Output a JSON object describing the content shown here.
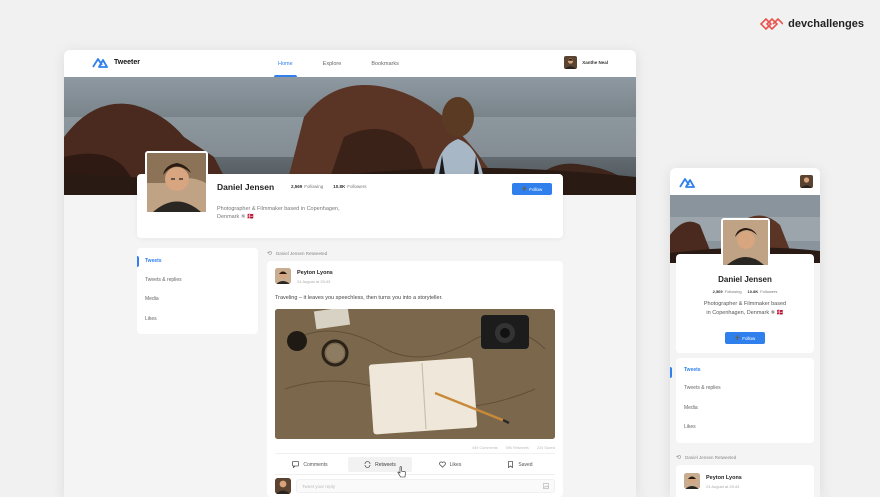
{
  "brand": {
    "name": "devchallenges"
  },
  "desktop": {
    "app_name": "Tweeter",
    "nav": [
      {
        "label": "Home",
        "active": true
      },
      {
        "label": "Explore",
        "active": false
      },
      {
        "label": "Bookmarks",
        "active": false
      }
    ],
    "current_user": "Xanthe Neal",
    "profile": {
      "name": "Daniel Jensen",
      "following_count": "2,569",
      "following_label": "Following",
      "followers_count": "10.8K",
      "followers_label": "Followers",
      "bio_line1": "Photographer & Filmmaker based in Copenhagen,",
      "bio_line2": "Denmark ✵ 🇩🇰",
      "follow_label": "Follow"
    },
    "filters": [
      {
        "label": "Tweets",
        "active": true
      },
      {
        "label": "Tweets & replies",
        "active": false
      },
      {
        "label": "Media",
        "active": false
      },
      {
        "label": "Likes",
        "active": false
      }
    ],
    "retweet_note": "Daniel Jensen Retweeted",
    "tweet": {
      "author": "Peyton Lyons",
      "date": "24 August at 20:43",
      "text": "Traveling – it leaves you speechless, then turns you into a storyteller.",
      "stats": {
        "comments": "449 Comments",
        "retweets": "59k Retweets",
        "saved": "234 Saved"
      },
      "actions": [
        {
          "label": "Comments",
          "icon": "comment-icon"
        },
        {
          "label": "Retweets",
          "icon": "retweet-icon"
        },
        {
          "label": "Likes",
          "icon": "heart-icon"
        },
        {
          "label": "Saved",
          "icon": "bookmark-icon"
        }
      ],
      "reply_placeholder": "Tweet your reply"
    }
  },
  "mobile": {
    "profile": {
      "name": "Daniel Jensen",
      "following_count": "2,569",
      "following_label": "Following",
      "followers_count": "10.8K",
      "followers_label": "Followers",
      "bio_line1": "Photographer & Filmmaker based",
      "bio_line2": "in Copenhagen, Denmark ✵ 🇩🇰",
      "follow_label": "Follow"
    },
    "filters": [
      {
        "label": "Tweets",
        "active": true
      },
      {
        "label": "Tweets & replies",
        "active": false
      },
      {
        "label": "Media",
        "active": false
      },
      {
        "label": "Likes",
        "active": false
      }
    ],
    "retweet_note": "Daniel Jensen Retweeted",
    "tweet": {
      "author": "Peyton Lyons",
      "date": "24 August at 20:43"
    }
  },
  "colors": {
    "accent": "#2f80ed",
    "brand": "#e8544c"
  }
}
